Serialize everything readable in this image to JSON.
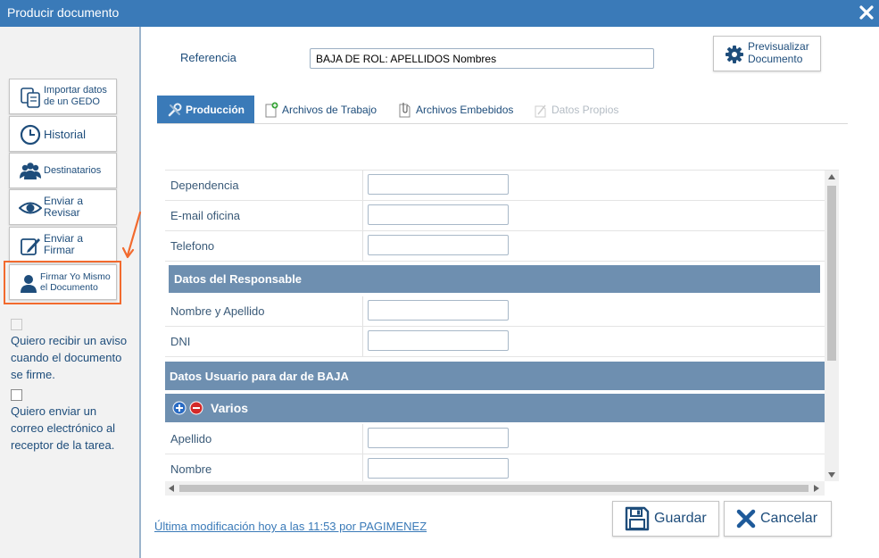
{
  "window": {
    "title": "Producir documento"
  },
  "sidebar": {
    "buttons": [
      {
        "label_line1": "Importar datos",
        "label_line2": "de un GEDO",
        "icon": "import-document-icon"
      },
      {
        "label": "Historial",
        "icon": "clock-icon"
      },
      {
        "label": "Destinatarios",
        "icon": "users-icon"
      },
      {
        "label_line1": "Enviar a",
        "label_line2": "Revisar",
        "icon": "eye-icon"
      },
      {
        "label_line1": "Enviar a",
        "label_line2": "Firmar",
        "icon": "pen-icon"
      },
      {
        "label_line1": "Firmar Yo Mismo",
        "label_line2": "el Documento",
        "icon": "user-icon"
      }
    ],
    "checkbox_notify": {
      "checked": false,
      "disabled": true,
      "lines": [
        "Quiero recibir un aviso",
        "cuando el documento",
        "se firme."
      ]
    },
    "checkbox_email": {
      "checked": false,
      "disabled": false,
      "lines": [
        "Quiero enviar un",
        "correo electrónico al",
        "receptor de la tarea."
      ]
    }
  },
  "header": {
    "reference_label": "Referencia",
    "reference_value": "BAJA DE ROL: APELLIDOS Nombres",
    "preview_line1": "Previsualizar",
    "preview_line2": "Documento"
  },
  "tabs": [
    {
      "label": "Producción",
      "active": true,
      "icon": "tools-icon"
    },
    {
      "label": "Archivos de Trabajo",
      "active": false,
      "icon": "add-file-icon"
    },
    {
      "label": "Archivos Embebidos",
      "active": false,
      "icon": "attachment-file-icon"
    },
    {
      "label": "Datos Propios",
      "active": false,
      "disabled": true,
      "icon": "edit-file-icon"
    }
  ],
  "form": {
    "fields_top": [
      {
        "label": "Dependencia",
        "value": ""
      },
      {
        "label": "E-mail oficina",
        "value": ""
      },
      {
        "label": "Telefono",
        "value": ""
      }
    ],
    "section_responsable": "Datos del Responsable",
    "fields_responsable": [
      {
        "label": "Nombre y Apellido",
        "value": ""
      },
      {
        "label": "DNI",
        "value": ""
      }
    ],
    "section_baja": "Datos Usuario para dar de BAJA",
    "section_varios": "Varios",
    "fields_varios": [
      {
        "label": "Apellido",
        "value": ""
      },
      {
        "label": "Nombre",
        "value": ""
      }
    ]
  },
  "footer": {
    "last_modified": "Última modificación hoy a las 11:53 por PAGIMENEZ",
    "save_label": "Guardar",
    "cancel_label": "Cancelar"
  },
  "colors": {
    "titlebar": "#3a7ab8",
    "section_header": "#6e8fb0",
    "accent_text": "#1e4d7b",
    "highlight": "#f26a2e",
    "cancel_icon": "#1e5a9a"
  }
}
